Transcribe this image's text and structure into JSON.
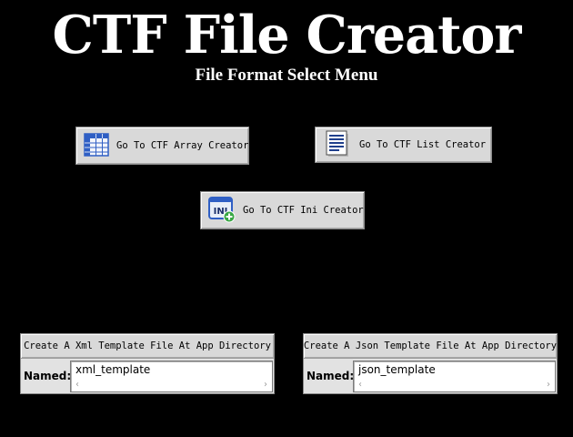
{
  "header": {
    "title": "CTF File Creator",
    "subtitle": "File Format Select Menu"
  },
  "buttons": {
    "array": {
      "label": "Go To CTF Array Creator",
      "icon": "grid-table-icon"
    },
    "list": {
      "label": "Go To CTF List Creator",
      "icon": "document-list-icon"
    },
    "ini": {
      "label": "Go To CTF Ini Creator",
      "icon": "ini-file-add-icon",
      "icon_text": "INI"
    }
  },
  "xml_panel": {
    "button_label": "Create A Xml Template File At App Directory",
    "named_label": "Named:",
    "value": "xml_template"
  },
  "json_panel": {
    "button_label": "Create A Json Template File At App Directory",
    "named_label": "Named:",
    "value": "json_template"
  },
  "scroll": {
    "left_arrow": "‹",
    "right_arrow": "›"
  },
  "colors": {
    "background": "#000000",
    "title": "#ffffff",
    "button_face": "#d9d9d9",
    "icon_blue": "#2f5fc4",
    "icon_green": "#3aa845"
  }
}
